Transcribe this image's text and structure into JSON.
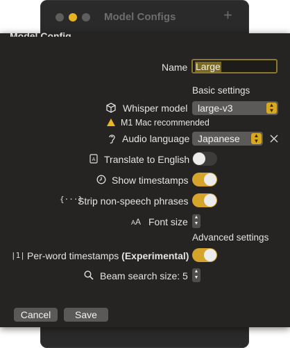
{
  "window": {
    "title": "Model Configs",
    "add_label": "+"
  },
  "sheet": {
    "title": "Model Config",
    "name_label": "Name",
    "name_value": "Large",
    "basic_settings": "Basic settings",
    "whisper_model_label": "Whisper model",
    "whisper_model_value": "large-v3",
    "mac_note": "M1 Mac recommended",
    "audio_language_label": "Audio language",
    "audio_language_value": "Japanese",
    "translate_label": "Translate to English",
    "translate_on": false,
    "timestamps_label": "Show timestamps",
    "timestamps_on": true,
    "strip_label": "Strip non-speech phrases",
    "strip_on": true,
    "font_size_label": "Font size",
    "advanced_settings": "Advanced settings",
    "per_word_label": "Per-word timestamps",
    "per_word_experimental": "(Experimental)",
    "per_word_on": true,
    "beam_label": "Beam search size: 5",
    "cancel_label": "Cancel",
    "save_label": "Save"
  },
  "colors": {
    "accent": "#d4a52a",
    "background": "#252423",
    "warning": "#e9b823"
  },
  "icons": [
    "cube-icon",
    "warning-icon",
    "ear-icon",
    "translate-icon",
    "clock-icon",
    "braces-icon",
    "font-size-icon",
    "per-word-icon",
    "magnifier-icon",
    "clear-icon"
  ]
}
